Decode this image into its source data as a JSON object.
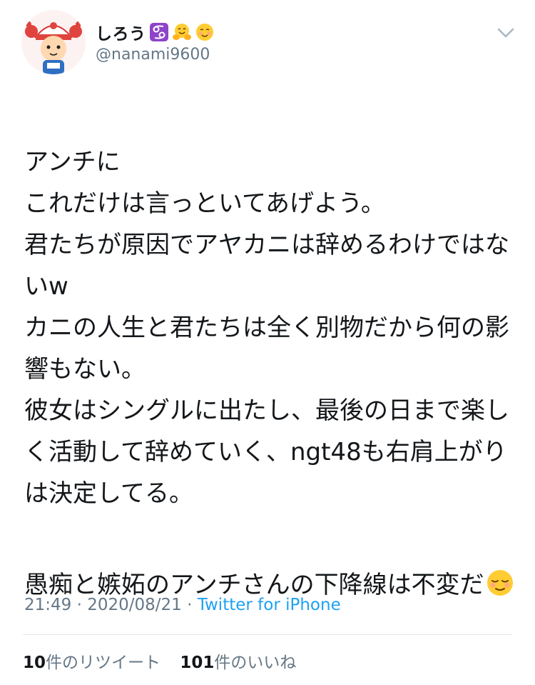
{
  "author": {
    "display_name": "しろう",
    "badges": [
      "cancer-zodiac-icon",
      "hugging-face-icon",
      "smiling-face-icon"
    ],
    "handle": "@nanami9600",
    "avatar": "character-avatar"
  },
  "tweet": {
    "paragraph1": "アンチに\nこれだけは言っといてあげよう。\n君たちが原因でアヤカニは辞めるわけではないw\nカニの人生と君たちは全く別物だから何の影響もない。\n彼女はシングルに出たし、最後の日まで楽しく活動して辞めていく、ngt48も右肩上がりは決定してる。",
    "paragraph2": "愚痴と嫉妬のアンチさんの下降線は不変だ",
    "trailing_emoji": "relieved-face-icon"
  },
  "meta": {
    "time": "21:49",
    "separator1": " · ",
    "date": "2020/08/21",
    "separator2": " · ",
    "source": "Twitter for iPhone"
  },
  "stats": {
    "retweet_count": "10",
    "retweet_label": "件のリツイート",
    "like_count": "101",
    "like_label": "件のいいね"
  },
  "colors": {
    "text": "#14171a",
    "secondary": "#657786",
    "link": "#1da1f2",
    "divider": "#e1e8ed"
  }
}
